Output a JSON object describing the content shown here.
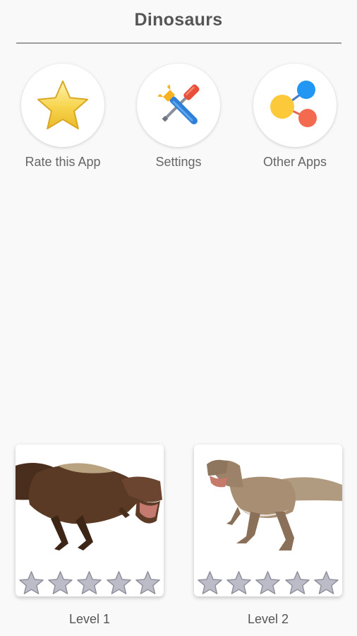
{
  "header": {
    "title": "Dinosaurs"
  },
  "actions": [
    {
      "label": "Rate this App",
      "icon": "star-icon"
    },
    {
      "label": "Settings",
      "icon": "tools-icon"
    },
    {
      "label": "Other Apps",
      "icon": "share-icon"
    }
  ],
  "levels": [
    {
      "label": "Level 1",
      "stars_earned": 0,
      "stars_total": 5,
      "image": "tyrannosaurus-image"
    },
    {
      "label": "Level 2",
      "stars_earned": 0,
      "stars_total": 5,
      "image": "allosaurus-image"
    }
  ],
  "colors": {
    "background": "#f9f9f9",
    "star_empty": "#bcbcc8",
    "star_gold": "#f5d24a",
    "share_blue": "#2196f3",
    "share_yellow": "#fcc93a",
    "share_red": "#f46a4f"
  }
}
